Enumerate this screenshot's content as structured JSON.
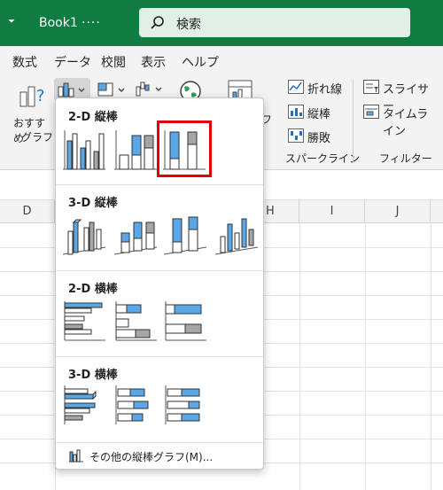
{
  "titlebar": {
    "menu_arrow": "⏷",
    "title": "Book1",
    "dots": "····",
    "search_label": "検索"
  },
  "menubar": {
    "items": [
      "数式",
      "データ",
      "校閲",
      "表示",
      "ヘルプ"
    ]
  },
  "ribbon": {
    "recommended_label_1": "おすすめ",
    "recommended_label_2": "グラフ",
    "sparkline": {
      "line": "折れ線",
      "column": "縦棒",
      "winloss": "勝敗",
      "group": "スパークライン"
    },
    "filter": {
      "slicer": "スライサー",
      "timeline": "タイムライン",
      "group": "フィルター"
    },
    "partial_label": "フ"
  },
  "sheet": {
    "columns": [
      "D",
      "H",
      "I",
      "J"
    ]
  },
  "dropdown": {
    "sections": [
      {
        "title": "2-D 縦棒"
      },
      {
        "title": "3-D 縦棒"
      },
      {
        "title": "2-D 横棒"
      },
      {
        "title": "3-D 横棒"
      }
    ],
    "footer": "その他の縦棒グラフ(M)..."
  },
  "colors": {
    "excel_green": "#107c41",
    "chart_blue": "#5aa7e8",
    "chart_gray": "#a6a6a6",
    "selection_red": "#e00000"
  }
}
